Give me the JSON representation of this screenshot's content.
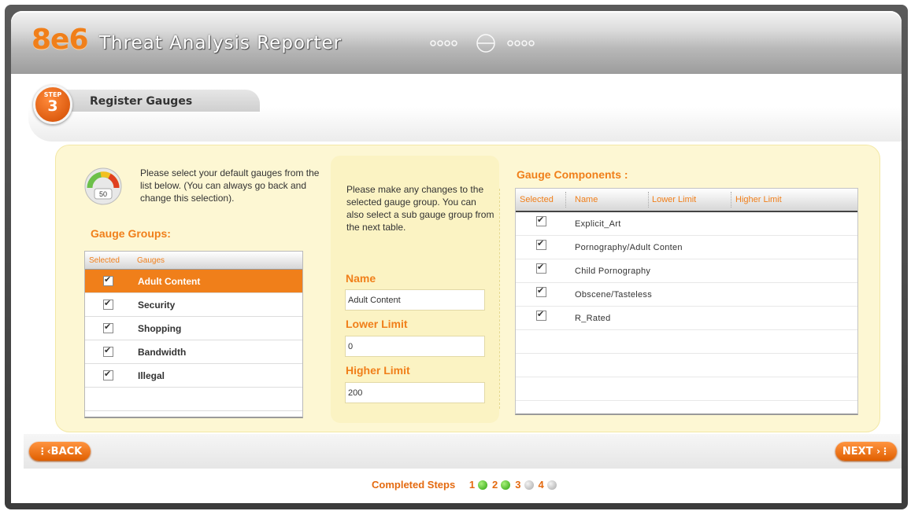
{
  "app": {
    "logo": "8e6",
    "title": "Threat Analysis Reporter"
  },
  "step": {
    "badge_top": "STEP",
    "badge_number": "3",
    "title": "Register Gauges"
  },
  "left": {
    "intro": "Please select your default gauges from the list below. (You can always go back and change this selection).",
    "gauge_icon_value": "50",
    "section_title": "Gauge Groups:",
    "table_headers": [
      "Selected",
      "Gauges"
    ],
    "groups": [
      {
        "label": "Adult Content",
        "checked": true,
        "selected": true
      },
      {
        "label": "Security",
        "checked": true,
        "selected": false
      },
      {
        "label": "Shopping",
        "checked": true,
        "selected": false
      },
      {
        "label": "Bandwidth",
        "checked": true,
        "selected": false
      },
      {
        "label": "Illegal",
        "checked": true,
        "selected": false
      }
    ]
  },
  "middle": {
    "intro": "Please make any changes to the selected gauge group. You can also select a sub gauge group from the next table.",
    "name_label": "Name",
    "name_value": "Adult Content",
    "lower_label": "Lower Limit",
    "lower_value": "0",
    "higher_label": "Higher Limit",
    "higher_value": "200"
  },
  "right": {
    "section_title": "Gauge Components :",
    "table_headers": [
      "Selected",
      "Name",
      "Lower Limit",
      "Higher Limit"
    ],
    "components": [
      {
        "name": "Explicit_Art",
        "checked": true
      },
      {
        "name": "Pornography/Adult Conten",
        "checked": true
      },
      {
        "name": "Child Pornography",
        "checked": true
      },
      {
        "name": "Obscene/Tasteless",
        "checked": true
      },
      {
        "name": "R_Rated",
        "checked": true
      }
    ]
  },
  "nav": {
    "back_label": "BACK",
    "next_label": "NEXT",
    "completed_label": "Completed Steps",
    "steps": [
      {
        "num": "1",
        "status": "done"
      },
      {
        "num": "2",
        "status": "done"
      },
      {
        "num": "3",
        "status": "todo"
      },
      {
        "num": "4",
        "status": "todo"
      }
    ]
  },
  "colors": {
    "accent": "#f07f1a",
    "panel": "#fdf7d3",
    "selected_row": "#f07f1a",
    "done_step": "#2aa10c"
  }
}
